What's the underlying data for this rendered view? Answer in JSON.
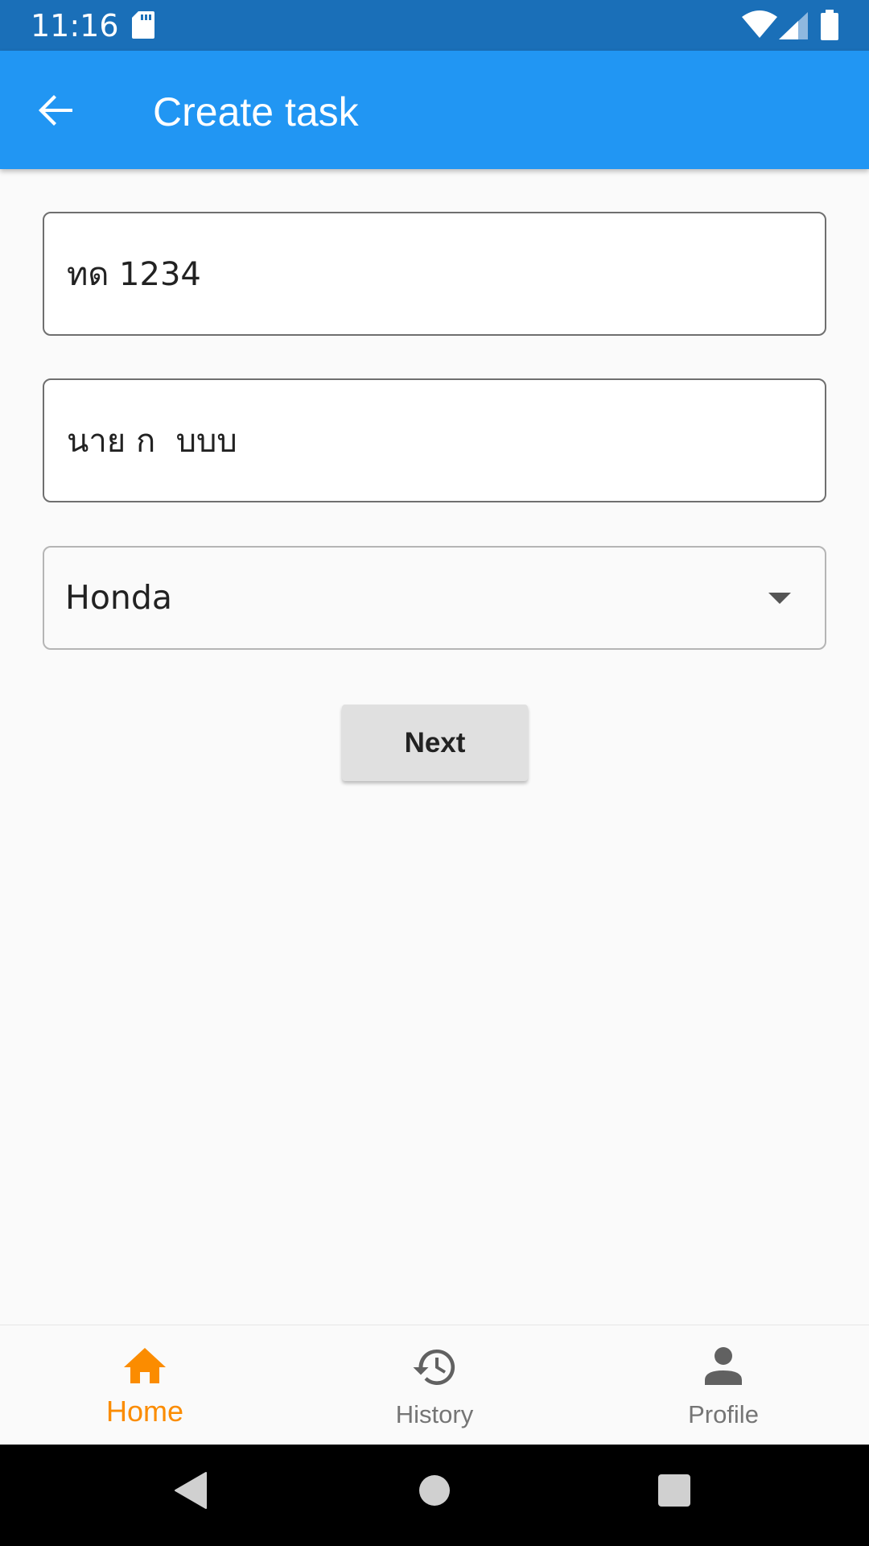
{
  "status_bar": {
    "time": "11:16",
    "icons": [
      "sd-card-icon",
      "wifi-icon",
      "signal-icon",
      "battery-icon"
    ]
  },
  "app_bar": {
    "title": "Create task",
    "back_icon": "arrow-back-icon"
  },
  "form": {
    "plate_field": {
      "value": "ทด 1234"
    },
    "name_field": {
      "value": "นาย ก  บบบ"
    },
    "brand_dropdown": {
      "selected": "Honda",
      "icon": "caret-down-icon"
    },
    "next_button": {
      "label": "Next"
    }
  },
  "bottom_nav": {
    "items": [
      {
        "label": "Home",
        "icon": "home-icon",
        "active": true
      },
      {
        "label": "History",
        "icon": "history-icon",
        "active": false
      },
      {
        "label": "Profile",
        "icon": "person-icon",
        "active": false
      }
    ]
  },
  "system_nav": {
    "buttons": [
      "back-triangle-icon",
      "home-circle-icon",
      "recents-square-icon"
    ]
  },
  "colors": {
    "status_bar": "#1a6fb8",
    "app_bar": "#2196f3",
    "accent_active": "#fb8c00",
    "inactive": "#757575",
    "button_bg": "#e0e0e0"
  }
}
